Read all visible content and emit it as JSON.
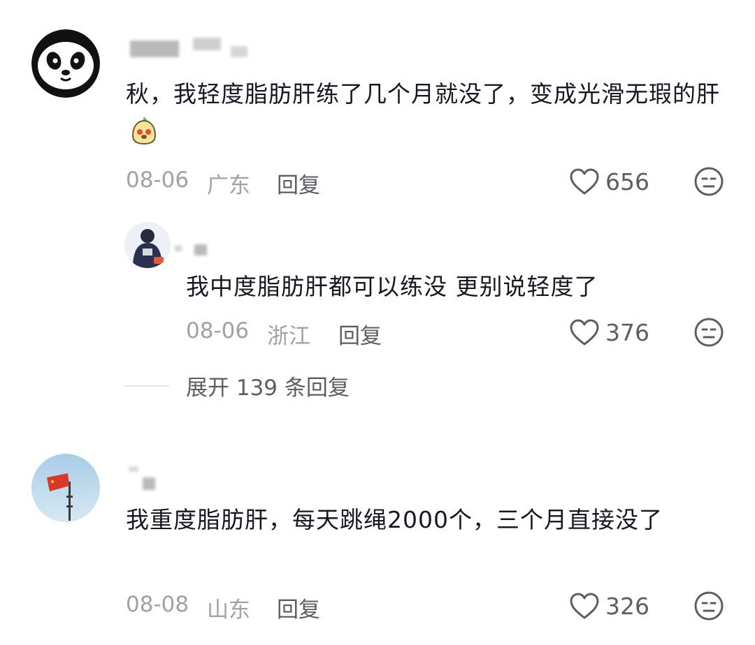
{
  "comments": [
    {
      "text": "秋，我轻度脂肪肝练了几个月就没了，变成光滑无瑕的肝",
      "emoji": "cute-sticker-emoji",
      "date": "08-06",
      "location": "广东",
      "reply_label": "回复",
      "likes": "656",
      "avatar": "panda-avatar",
      "replies": [
        {
          "text": "我中度脂肪肝都可以练没 更别说轻度了",
          "date": "08-06",
          "location": "浙江",
          "reply_label": "回复",
          "likes": "376",
          "avatar": "person-hoodie-avatar"
        }
      ],
      "expand_label": "展开 139 条回复"
    },
    {
      "text": "我重度脂肪肝，每天跳绳2000个，三个月直接没了",
      "date": "08-08",
      "location": "山东",
      "reply_label": "回复",
      "likes": "326",
      "avatar": "red-flag-sky-avatar"
    }
  ],
  "colors": {
    "text_primary": "#161823",
    "text_meta": "#a1a1a6",
    "text_secondary": "#5d5d63"
  }
}
